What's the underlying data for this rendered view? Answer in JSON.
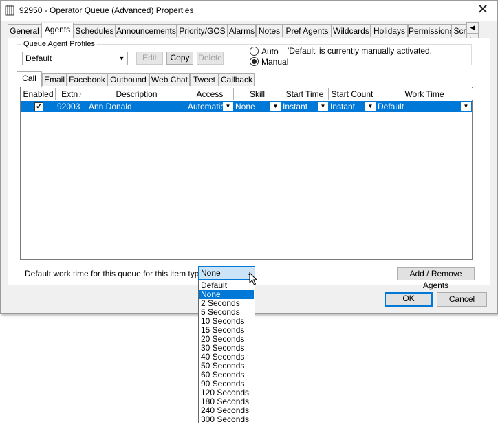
{
  "window": {
    "title": "92950 - Operator Queue (Advanced) Properties",
    "close_glyph": "✕"
  },
  "tabs": [
    "General",
    "Agents",
    "Schedules",
    "Announcements",
    "Priority/GOS",
    "Alarms",
    "Notes",
    "Pref Agents",
    "Wildcards",
    "Holidays",
    "Permissions",
    "Scr"
  ],
  "active_tab": "Agents",
  "profiles": {
    "group_label": "Queue Agent Profiles",
    "selected": "Default",
    "edit_label": "Edit",
    "copy_label": "Copy",
    "delete_label": "Delete",
    "auto_label": "Auto",
    "manual_label": "Manual",
    "mode": "Manual",
    "status": "'Default' is currently manually activated."
  },
  "subtabs": [
    "Call",
    "Email",
    "Facebook",
    "Outbound",
    "Web Chat",
    "Tweet",
    "Callback"
  ],
  "active_subtab": "Call",
  "grid": {
    "columns": [
      "Enabled",
      "Extn",
      "Description",
      "Access",
      "Skill",
      "Start Time",
      "Start Count",
      "Work Time"
    ],
    "rows": [
      {
        "enabled": true,
        "extn": "92003",
        "description": "Ann Donald",
        "access": "Automatic",
        "skill": "None",
        "start_time": "Instant",
        "start_count": "Instant",
        "work_time": "Default"
      }
    ]
  },
  "bottom": {
    "default_work_label": "Default work time for this queue for this item type:",
    "dropdown_value": "None",
    "add_remove_label": "Add / Remove Agents",
    "ok_label": "OK",
    "cancel_label": "Cancel"
  },
  "dropdown": {
    "options": [
      "Default",
      "None",
      "2 Seconds",
      "5 Seconds",
      "10 Seconds",
      "15 Seconds",
      "20 Seconds",
      "30 Seconds",
      "40 Seconds",
      "50 Seconds",
      "60 Seconds",
      "90 Seconds",
      "120 Seconds",
      "180 Seconds",
      "240 Seconds",
      "300 Seconds"
    ],
    "selected": "None"
  },
  "colors": {
    "accent": "#0078d7",
    "dialog_bg": "#f0f0f0"
  },
  "icons": {
    "app": "queue-app-icon",
    "close": "close-icon",
    "tab_left": "chevron-left-icon",
    "tab_right": "chevron-right-icon",
    "dropdown": "chevron-down-icon"
  }
}
